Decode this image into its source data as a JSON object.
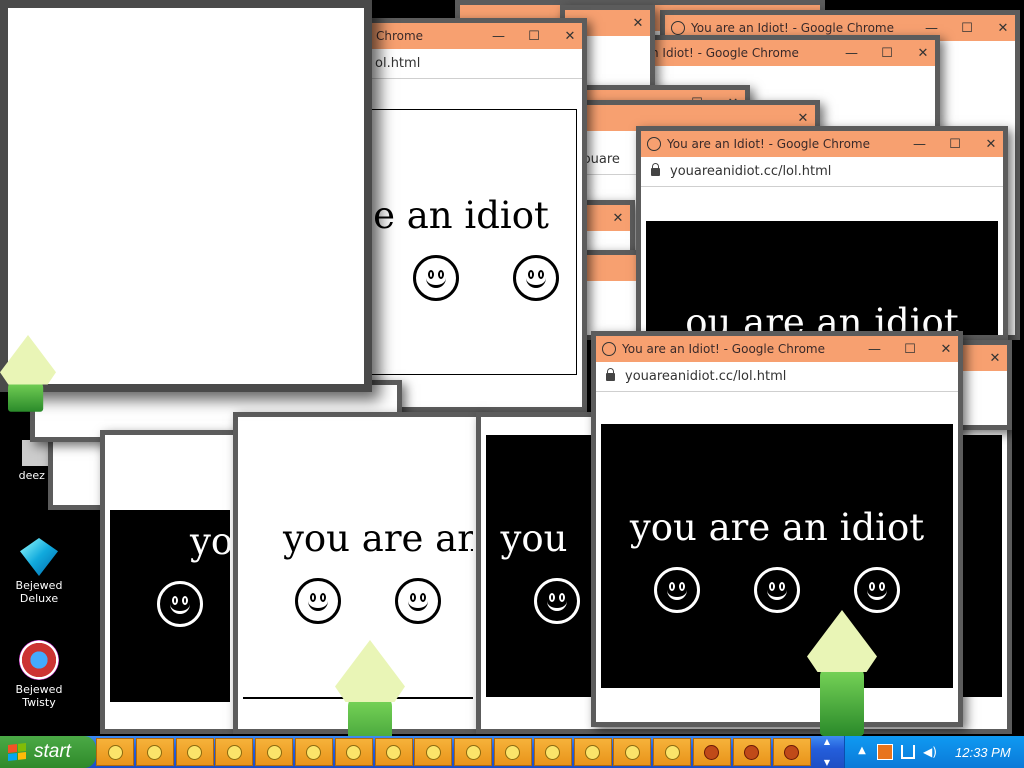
{
  "window_title": "You are an Idiot! - Google Chrome",
  "window_title_partial_1": "n Idiot! - Google Chrome",
  "window_title_partial_2": "Chrome",
  "url": "youareanidiot.cc/lol.html",
  "url_partial_1": "ol.html",
  "url_partial_2": "youare",
  "message": "you are an idiot",
  "message_partial_1": "e an idiot",
  "message_partial_2": "ou are an idiot",
  "message_partial_3": "you are an",
  "message_partial_4": "you",
  "desktop": {
    "icon_deez": "deez n",
    "icon_bejeweled_deluxe": "Bejewed Deluxe",
    "icon_bejeweled_twisty": "Bejewed Twisty"
  },
  "taskbar": {
    "start_label": "start",
    "clock": "12:33 PM",
    "task_icons": [
      "smiley",
      "smiley",
      "smiley",
      "smiley",
      "smiley",
      "smiley",
      "smiley",
      "smiley",
      "smiley",
      "smiley",
      "smiley",
      "smiley",
      "smiley",
      "smiley",
      "smiley",
      "chrome",
      "chrome",
      "chrome"
    ]
  }
}
